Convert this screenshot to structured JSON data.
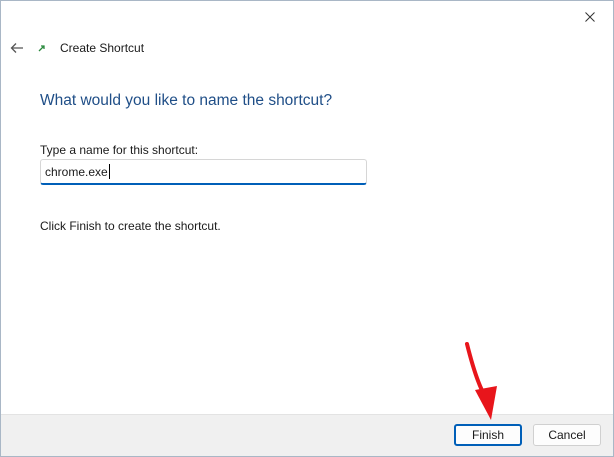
{
  "window": {
    "title": "Create Shortcut",
    "icons": {
      "close": "close-icon",
      "back": "back-arrow-icon",
      "app": "shortcut-icon"
    }
  },
  "wizard": {
    "heading": "What would you like to name the shortcut?",
    "name_label": "Type a name for this shortcut:",
    "name_value": "chrome.exe",
    "info": "Click Finish to create the shortcut."
  },
  "footer": {
    "finish_label": "Finish",
    "cancel_label": "Cancel"
  },
  "colors": {
    "accent": "#005fb8",
    "heading": "#1f4e87",
    "annotation": "#e8151b"
  }
}
